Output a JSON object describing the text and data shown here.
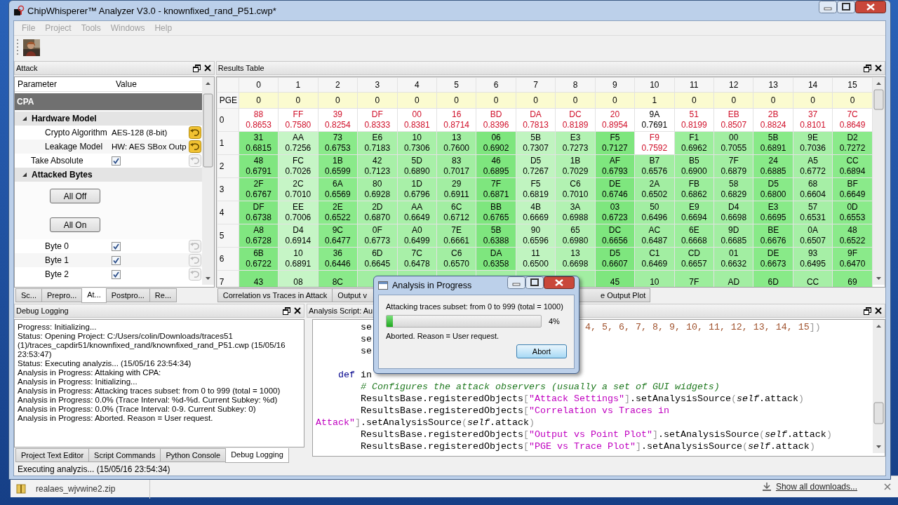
{
  "window": {
    "title": "ChipWhisperer™ Analyzer V3.0 - knownfixed_rand_P51.cwp*"
  },
  "menu": [
    {
      "label": "File",
      "disabled": true
    },
    {
      "label": "Project",
      "disabled": true
    },
    {
      "label": "Tools",
      "disabled": true
    },
    {
      "label": "Windows",
      "disabled": true
    },
    {
      "label": "Help",
      "disabled": true
    }
  ],
  "attack_panel": {
    "title": "Attack",
    "columns": [
      "Parameter",
      "Value"
    ],
    "tree": [
      {
        "kind": "group",
        "label": "CPA",
        "children": [
          {
            "kind": "section",
            "label": "Hardware Model",
            "expanded": true,
            "children": [
              {
                "kind": "value",
                "label": "Crypto Algorithm",
                "value": "AES-128 (8-bit)",
                "modified": true
              },
              {
                "kind": "value",
                "label": "Leakage Model",
                "value": "HW: AES SBox Outp",
                "modified": true
              }
            ]
          },
          {
            "kind": "check",
            "label": "Take Absolute",
            "checked": true,
            "modified": false
          },
          {
            "kind": "section",
            "label": "Attacked Bytes",
            "expanded": true,
            "children": [
              {
                "kind": "button",
                "label": "All Off"
              },
              {
                "kind": "button",
                "label": "All On"
              },
              {
                "kind": "check",
                "label": "Byte 0",
                "checked": true,
                "modified": false
              },
              {
                "kind": "check",
                "label": "Byte 1",
                "checked": true,
                "modified": false
              },
              {
                "kind": "check",
                "label": "Byte 2",
                "checked": true,
                "modified": false
              }
            ]
          }
        ]
      }
    ],
    "tabs": [
      {
        "label": "Sc...",
        "selected": false
      },
      {
        "label": "Prepro...",
        "selected": false
      },
      {
        "label": "At...",
        "selected": true
      },
      {
        "label": "Postpro...",
        "selected": false
      },
      {
        "label": "Re...",
        "selected": false
      }
    ]
  },
  "results_panel": {
    "title": "Results Table",
    "table": {
      "columns": [
        {
          "label": "0",
          "color": "#80e680"
        },
        {
          "label": "1",
          "color": "#c6f5c6"
        },
        {
          "label": "2",
          "color": "#8aea8a"
        },
        {
          "label": "3",
          "color": "#a8f0a8"
        },
        {
          "label": "4",
          "color": "#a8f0a8"
        },
        {
          "label": "5",
          "color": "#a2eea2"
        },
        {
          "label": "6",
          "color": "#7ee67e"
        },
        {
          "label": "7",
          "color": "#c0f4c0"
        },
        {
          "label": "8",
          "color": "#b2f2b2"
        },
        {
          "label": "9",
          "color": "#7ee67e"
        },
        {
          "label": "10",
          "color": "#a2eea2"
        },
        {
          "label": "11",
          "color": "#9cee9c"
        },
        {
          "label": "12",
          "color": "#a2eea2"
        },
        {
          "label": "13",
          "color": "#88ea88"
        },
        {
          "label": "14",
          "color": "#a6efa6"
        },
        {
          "label": "15",
          "color": "#8aea8a"
        }
      ],
      "pge": {
        "label": "PGE",
        "values": [
          "0",
          "0",
          "0",
          "0",
          "0",
          "0",
          "0",
          "0",
          "0",
          "0",
          "1",
          "0",
          "0",
          "0",
          "0",
          "0"
        ]
      },
      "rows": [
        {
          "label": "0",
          "kind": "top",
          "cells": [
            {
              "byte": "88",
              "corr": "0.8653",
              "correct": true
            },
            {
              "byte": "FF",
              "corr": "0.7580",
              "correct": true
            },
            {
              "byte": "39",
              "corr": "0.8254",
              "correct": true
            },
            {
              "byte": "DF",
              "corr": "0.8333",
              "correct": true
            },
            {
              "byte": "00",
              "corr": "0.8381",
              "correct": true
            },
            {
              "byte": "16",
              "corr": "0.8714",
              "correct": true
            },
            {
              "byte": "BD",
              "corr": "0.8396",
              "correct": true
            },
            {
              "byte": "DA",
              "corr": "0.7813",
              "correct": true
            },
            {
              "byte": "DC",
              "corr": "0.8189",
              "correct": true
            },
            {
              "byte": "20",
              "corr": "0.8954",
              "correct": true
            },
            {
              "byte": "9A",
              "corr": "0.7691",
              "correct": false
            },
            {
              "byte": "51",
              "corr": "0.8199",
              "correct": true
            },
            {
              "byte": "EB",
              "corr": "0.8507",
              "correct": true
            },
            {
              "byte": "2B",
              "corr": "0.8824",
              "correct": true
            },
            {
              "byte": "37",
              "corr": "0.8101",
              "correct": true
            },
            {
              "byte": "7C",
              "corr": "0.8649",
              "correct": true
            }
          ]
        },
        {
          "label": "1",
          "kind": "rank",
          "cells": [
            {
              "byte": "31",
              "corr": "0.6815",
              "correct": false
            },
            {
              "byte": "AA",
              "corr": "0.7256",
              "correct": false
            },
            {
              "byte": "73",
              "corr": "0.6753",
              "correct": false
            },
            {
              "byte": "E6",
              "corr": "0.7183",
              "correct": false
            },
            {
              "byte": "10",
              "corr": "0.7306",
              "correct": false
            },
            {
              "byte": "13",
              "corr": "0.7600",
              "correct": false
            },
            {
              "byte": "06",
              "corr": "0.6902",
              "correct": false
            },
            {
              "byte": "5B",
              "corr": "0.7307",
              "correct": false
            },
            {
              "byte": "E3",
              "corr": "0.7273",
              "correct": false
            },
            {
              "byte": "F5",
              "corr": "0.7127",
              "correct": false
            },
            {
              "byte": "F9",
              "corr": "0.7592",
              "correct": true
            },
            {
              "byte": "F1",
              "corr": "0.6962",
              "correct": false
            },
            {
              "byte": "00",
              "corr": "0.7055",
              "correct": false
            },
            {
              "byte": "5B",
              "corr": "0.6891",
              "correct": false
            },
            {
              "byte": "9E",
              "corr": "0.7036",
              "correct": false
            },
            {
              "byte": "D2",
              "corr": "0.7272",
              "correct": false
            }
          ]
        },
        {
          "label": "2",
          "kind": "rank",
          "cells": [
            {
              "byte": "48",
              "corr": "0.6791",
              "correct": false
            },
            {
              "byte": "FC",
              "corr": "0.7026",
              "correct": false
            },
            {
              "byte": "1B",
              "corr": "0.6599",
              "correct": false
            },
            {
              "byte": "42",
              "corr": "0.7123",
              "correct": false
            },
            {
              "byte": "5D",
              "corr": "0.6890",
              "correct": false
            },
            {
              "byte": "83",
              "corr": "0.7017",
              "correct": false
            },
            {
              "byte": "46",
              "corr": "0.6895",
              "correct": false
            },
            {
              "byte": "D5",
              "corr": "0.7267",
              "correct": false
            },
            {
              "byte": "1B",
              "corr": "0.7029",
              "correct": false
            },
            {
              "byte": "AF",
              "corr": "0.6793",
              "correct": false
            },
            {
              "byte": "B7",
              "corr": "0.6576",
              "correct": false
            },
            {
              "byte": "B5",
              "corr": "0.6900",
              "correct": false
            },
            {
              "byte": "7F",
              "corr": "0.6879",
              "correct": false
            },
            {
              "byte": "24",
              "corr": "0.6885",
              "correct": false
            },
            {
              "byte": "A5",
              "corr": "0.6772",
              "correct": false
            },
            {
              "byte": "CC",
              "corr": "0.6894",
              "correct": false
            }
          ]
        },
        {
          "label": "3",
          "kind": "rank",
          "cells": [
            {
              "byte": "2F",
              "corr": "0.6767",
              "correct": false
            },
            {
              "byte": "2C",
              "corr": "0.7010",
              "correct": false
            },
            {
              "byte": "6A",
              "corr": "0.6569",
              "correct": false
            },
            {
              "byte": "80",
              "corr": "0.6928",
              "correct": false
            },
            {
              "byte": "1D",
              "corr": "0.6796",
              "correct": false
            },
            {
              "byte": "29",
              "corr": "0.6911",
              "correct": false
            },
            {
              "byte": "7F",
              "corr": "0.6871",
              "correct": false
            },
            {
              "byte": "F5",
              "corr": "0.6819",
              "correct": false
            },
            {
              "byte": "C6",
              "corr": "0.7010",
              "correct": false
            },
            {
              "byte": "DE",
              "corr": "0.6746",
              "correct": false
            },
            {
              "byte": "2A",
              "corr": "0.6502",
              "correct": false
            },
            {
              "byte": "FB",
              "corr": "0.6862",
              "correct": false
            },
            {
              "byte": "58",
              "corr": "0.6829",
              "correct": false
            },
            {
              "byte": "D5",
              "corr": "0.6800",
              "correct": false
            },
            {
              "byte": "68",
              "corr": "0.6604",
              "correct": false
            },
            {
              "byte": "BF",
              "corr": "0.6649",
              "correct": false
            }
          ]
        },
        {
          "label": "4",
          "kind": "rank",
          "cells": [
            {
              "byte": "DF",
              "corr": "0.6738",
              "correct": false
            },
            {
              "byte": "EE",
              "corr": "0.7006",
              "correct": false
            },
            {
              "byte": "2E",
              "corr": "0.6522",
              "correct": false
            },
            {
              "byte": "2D",
              "corr": "0.6870",
              "correct": false
            },
            {
              "byte": "AA",
              "corr": "0.6649",
              "correct": false
            },
            {
              "byte": "6C",
              "corr": "0.6712",
              "correct": false
            },
            {
              "byte": "BB",
              "corr": "0.6765",
              "correct": false
            },
            {
              "byte": "4B",
              "corr": "0.6669",
              "correct": false
            },
            {
              "byte": "3A",
              "corr": "0.6988",
              "correct": false
            },
            {
              "byte": "03",
              "corr": "0.6723",
              "correct": false
            },
            {
              "byte": "50",
              "corr": "0.6496",
              "correct": false
            },
            {
              "byte": "E9",
              "corr": "0.6694",
              "correct": false
            },
            {
              "byte": "D4",
              "corr": "0.6698",
              "correct": false
            },
            {
              "byte": "E3",
              "corr": "0.6695",
              "correct": false
            },
            {
              "byte": "57",
              "corr": "0.6531",
              "correct": false
            },
            {
              "byte": "0D",
              "corr": "0.6553",
              "correct": false
            }
          ]
        },
        {
          "label": "5",
          "kind": "rank",
          "cells": [
            {
              "byte": "A8",
              "corr": "0.6728",
              "correct": false
            },
            {
              "byte": "D4",
              "corr": "0.6914",
              "correct": false
            },
            {
              "byte": "9C",
              "corr": "0.6477",
              "correct": false
            },
            {
              "byte": "0F",
              "corr": "0.6773",
              "correct": false
            },
            {
              "byte": "A0",
              "corr": "0.6499",
              "correct": false
            },
            {
              "byte": "7E",
              "corr": "0.6661",
              "correct": false
            },
            {
              "byte": "5B",
              "corr": "0.6388",
              "correct": false
            },
            {
              "byte": "90",
              "corr": "0.6596",
              "correct": false
            },
            {
              "byte": "65",
              "corr": "0.6980",
              "correct": false
            },
            {
              "byte": "DC",
              "corr": "0.6656",
              "correct": false
            },
            {
              "byte": "AC",
              "corr": "0.6487",
              "correct": false
            },
            {
              "byte": "6E",
              "corr": "0.6668",
              "correct": false
            },
            {
              "byte": "9D",
              "corr": "0.6685",
              "correct": false
            },
            {
              "byte": "BE",
              "corr": "0.6676",
              "correct": false
            },
            {
              "byte": "0A",
              "corr": "0.6507",
              "correct": false
            },
            {
              "byte": "48",
              "corr": "0.6522",
              "correct": false
            }
          ]
        },
        {
          "label": "6",
          "kind": "rank",
          "cells": [
            {
              "byte": "6B",
              "corr": "0.6722",
              "correct": false
            },
            {
              "byte": "10",
              "corr": "0.6891",
              "correct": false
            },
            {
              "byte": "36",
              "corr": "0.6446",
              "correct": false
            },
            {
              "byte": "6D",
              "corr": "0.6645",
              "correct": false
            },
            {
              "byte": "7C",
              "corr": "0.6478",
              "correct": false
            },
            {
              "byte": "C6",
              "corr": "0.6570",
              "correct": false
            },
            {
              "byte": "DA",
              "corr": "0.6358",
              "correct": false
            },
            {
              "byte": "11",
              "corr": "0.6500",
              "correct": false
            },
            {
              "byte": "13",
              "corr": "0.6698",
              "correct": false
            },
            {
              "byte": "D5",
              "corr": "0.6607",
              "correct": false
            },
            {
              "byte": "C1",
              "corr": "0.6469",
              "correct": false
            },
            {
              "byte": "CD",
              "corr": "0.6657",
              "correct": false
            },
            {
              "byte": "01",
              "corr": "0.6632",
              "correct": false
            },
            {
              "byte": "DE",
              "corr": "0.6673",
              "correct": false
            },
            {
              "byte": "93",
              "corr": "0.6495",
              "correct": false
            },
            {
              "byte": "9F",
              "corr": "0.6470",
              "correct": false
            }
          ]
        },
        {
          "label": "7",
          "kind": "rank",
          "cells": [
            {
              "byte": "43",
              "correct": false
            },
            {
              "byte": "08",
              "correct": false
            },
            {
              "byte": "8C",
              "correct": false
            },
            null,
            null,
            null,
            null,
            null,
            null,
            {
              "byte": "45",
              "correct": false
            },
            {
              "byte": "10",
              "correct": false
            },
            {
              "byte": "7F",
              "correct": false
            },
            {
              "byte": "AD",
              "correct": false
            },
            {
              "byte": "6D",
              "correct": false
            },
            {
              "byte": "CC",
              "correct": false
            },
            {
              "byte": "69",
              "correct": false
            }
          ]
        }
      ]
    },
    "tabs": [
      {
        "label": "Correlation vs Traces in Attack",
        "selected": false
      },
      {
        "label": "Output v",
        "selected": false
      },
      {
        "label": "e Output Plot",
        "selected": false
      }
    ]
  },
  "debug_panel": {
    "title": "Debug Logging",
    "lines": [
      "Progress: Initializing...",
      "Status: Opening Project: C:/Users/colin/Downloads/traces51 (1)/traces_capdir51/knownfixed_rand/knownfixed_rand_P51.cwp (15/05/16 23:53:47)",
      "Status: Executing analyzis... (15/05/16 23:54:34)",
      "Analysis in Progress: Attaking with CPA:",
      "Analysis in Progress: Initializing...",
      "Analysis in Progress: Attacking traces subset: from 0 to 999 (total = 1000)",
      "Analysis in Progress: 0.0% (Trace Interval: %d-%d. Current Subkey: %d)",
      "Analysis in Progress: 0.0% (Trace Interval: 0-9. Current Subkey: 0)",
      "Analysis in Progress: Aborted. Reason = User request."
    ],
    "tabs": [
      {
        "label": "Project Text Editor",
        "selected": false
      },
      {
        "label": "Script Commands",
        "selected": false
      },
      {
        "label": "Python Console",
        "selected": false
      },
      {
        "label": "Debug Logging",
        "selected": true
      }
    ]
  },
  "script_panel": {
    "title": "Analysis Script: Au",
    "lines": [
      {
        "kind": "code",
        "tokens": [
          {
            "kind": "plain",
            "text": "        se                                      "
          },
          {
            "kind": "number",
            "text": "4, 5, 6, 7, 8, 9, 10, 11, 12, 13, 14, 15"
          },
          {
            "kind": "bracket",
            "text": "])"
          }
        ]
      },
      {
        "kind": "code",
        "tokens": [
          {
            "kind": "plain",
            "text": "        se"
          }
        ]
      },
      {
        "kind": "code",
        "tokens": [
          {
            "kind": "plain",
            "text": "        se"
          }
        ]
      },
      {
        "kind": "blank"
      },
      {
        "kind": "code",
        "tokens": [
          {
            "kind": "keyword",
            "text": "    def"
          },
          {
            "kind": "plain",
            "text": " in"
          }
        ]
      },
      {
        "kind": "code",
        "tokens": [
          {
            "kind": "comment",
            "text": "        # Configures the attack observers (usually a set of GUI widgets)"
          }
        ]
      },
      {
        "kind": "code",
        "tokens": [
          {
            "kind": "plain",
            "text": "        ResultsBase.registeredObjects"
          },
          {
            "kind": "bracket",
            "text": "["
          },
          {
            "kind": "string",
            "text": "\"Attack Settings\""
          },
          {
            "kind": "bracket",
            "text": "]"
          },
          {
            "kind": "plain",
            "text": ".setAnalysisSource"
          },
          {
            "kind": "bracket",
            "text": "("
          },
          {
            "kind": "self",
            "text": "self"
          },
          {
            "kind": "plain",
            "text": ".attack"
          },
          {
            "kind": "bracket",
            "text": ")"
          }
        ]
      },
      {
        "kind": "code",
        "tokens": [
          {
            "kind": "plain",
            "text": "        ResultsBase.registeredObjects"
          },
          {
            "kind": "bracket",
            "text": "["
          },
          {
            "kind": "string",
            "text": "\"Correlation vs Traces in"
          }
        ]
      },
      {
        "kind": "code",
        "tokens": [
          {
            "kind": "string",
            "text": "Attack\""
          },
          {
            "kind": "bracket",
            "text": "]"
          },
          {
            "kind": "plain",
            "text": ".setAnalysisSource"
          },
          {
            "kind": "bracket",
            "text": "("
          },
          {
            "kind": "self",
            "text": "self"
          },
          {
            "kind": "plain",
            "text": ".attack"
          },
          {
            "kind": "bracket",
            "text": ")"
          }
        ]
      },
      {
        "kind": "code",
        "tokens": [
          {
            "kind": "plain",
            "text": "        ResultsBase.registeredObjects"
          },
          {
            "kind": "bracket",
            "text": "["
          },
          {
            "kind": "string",
            "text": "\"Output vs Point Plot\""
          },
          {
            "kind": "bracket",
            "text": "]"
          },
          {
            "kind": "plain",
            "text": ".setAnalysisSource"
          },
          {
            "kind": "bracket",
            "text": "("
          },
          {
            "kind": "self",
            "text": "self"
          },
          {
            "kind": "plain",
            "text": ".attack"
          },
          {
            "kind": "bracket",
            "text": ")"
          }
        ]
      },
      {
        "kind": "code",
        "tokens": [
          {
            "kind": "plain",
            "text": "        ResultsBase.registeredObjects"
          },
          {
            "kind": "bracket",
            "text": "["
          },
          {
            "kind": "string",
            "text": "\"PGE vs Trace Plot\""
          },
          {
            "kind": "bracket",
            "text": "]"
          },
          {
            "kind": "plain",
            "text": ".setAnalysisSource"
          },
          {
            "kind": "bracket",
            "text": "("
          },
          {
            "kind": "self",
            "text": "self"
          },
          {
            "kind": "plain",
            "text": ".attack"
          },
          {
            "kind": "bracket",
            "text": ")"
          }
        ]
      }
    ]
  },
  "status_bar": "Executing analyzis... (15/05/16 23:54:34)",
  "dialog": {
    "title": "Analysis in Progress",
    "message": "Attacking traces subset: from 0 to 999 (total = 1000)",
    "level": 0.04,
    "percent": "4%",
    "note": "Aborted. Reason = User request.",
    "button": "Abort"
  },
  "downloads_bar": {
    "items": [
      {
        "label": "realaes_wjvwine2.zip"
      }
    ],
    "show_all": "Show all downloads..."
  }
}
